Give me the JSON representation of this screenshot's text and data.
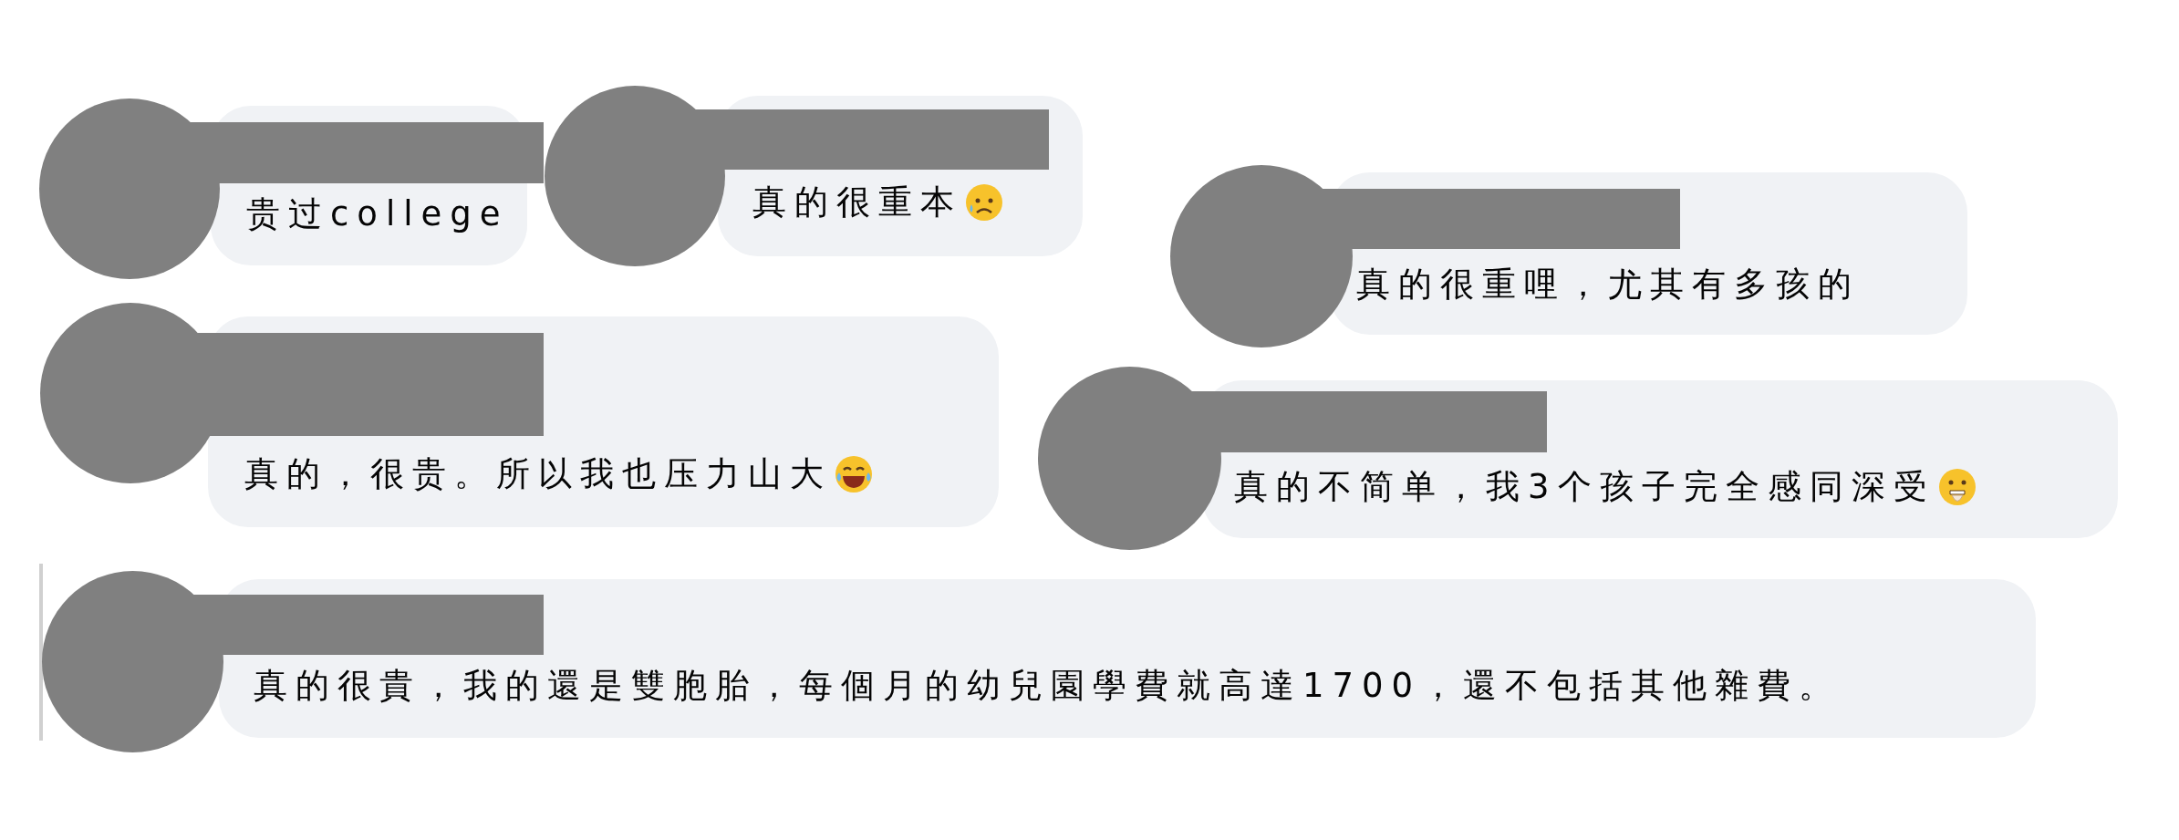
{
  "comments": [
    {
      "text": "贵过college",
      "kind": "plain",
      "thread_line": false
    },
    {
      "text": "真的很重本",
      "kind": "sad",
      "thread_line": false
    },
    {
      "text": "真的很重哩，尤其有多孩的",
      "kind": "plain",
      "thread_line": false
    },
    {
      "text": "真的，很贵。所以我也压力山大",
      "kind": "laughing",
      "thread_line": false
    },
    {
      "text": "真的不简单，我3个孩子完全感同深受",
      "kind": "gasp",
      "thread_line": false
    },
    {
      "text": "真的很貴，我的還是雙胞胎，每個月的幼兒園學費就高達1700，還不包括其他雜費。",
      "kind": "plain",
      "thread_line": true
    }
  ]
}
